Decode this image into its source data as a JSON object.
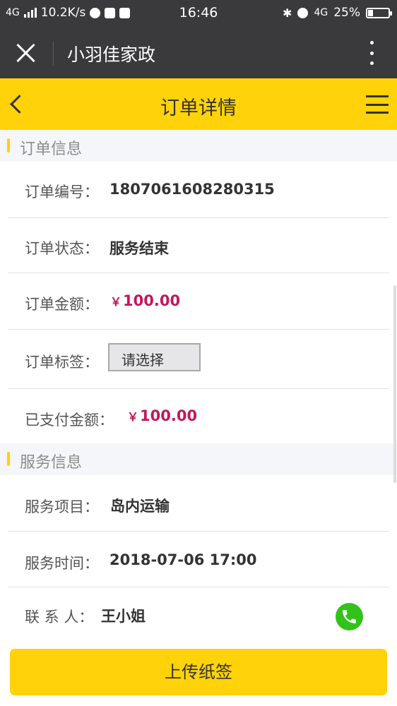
{
  "status_bar": {
    "network": "4G",
    "speed": "10.2K/s",
    "time": "16:46",
    "network_right": "4G",
    "battery": "25%"
  },
  "wechat_bar": {
    "title": "小羽佳家政"
  },
  "header": {
    "title": "订单详情"
  },
  "order_section": {
    "title": "订单信息",
    "rows": [
      {
        "label": "订单编号：",
        "value": "1807061608280315"
      },
      {
        "label": "订单状态：",
        "value": "服务结束"
      },
      {
        "label": "订单金额：",
        "currency": "￥",
        "value": "100.00"
      },
      {
        "label": "订单标签：",
        "select_value": "请选择"
      },
      {
        "label": "已支付金额：",
        "currency": "￥",
        "value": "100.00"
      }
    ]
  },
  "service_section": {
    "title": "服务信息",
    "rows": [
      {
        "label": "服务项目：",
        "value": "岛内运输"
      },
      {
        "label": "服务时间：",
        "value": "2018-07-06 17:00"
      },
      {
        "label": "联 系 人：",
        "value": "王小姐"
      }
    ]
  },
  "footer": {
    "upload_label": "上传纸签"
  },
  "colors": {
    "brand_yellow": "#ffd20a",
    "money": "#c0185c",
    "call_green": "#33c21a",
    "dark_bar": "#3a3a3c"
  },
  "icons": {
    "back": "chevron-left-icon",
    "menu": "hamburger-menu-icon",
    "close": "close-icon",
    "more": "more-vertical-icon",
    "call": "phone-icon"
  }
}
